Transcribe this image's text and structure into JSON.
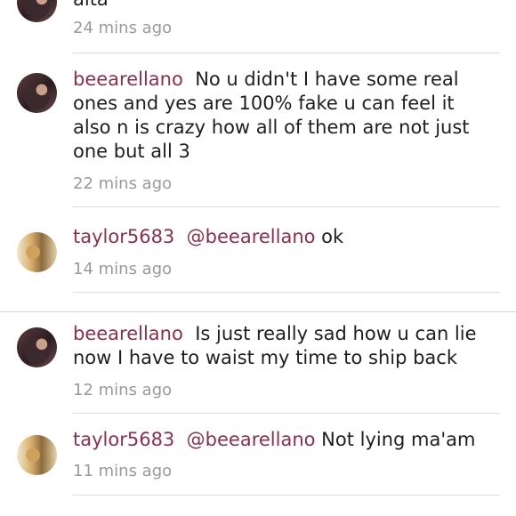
{
  "comments": [
    {
      "username": "",
      "text": "alta",
      "time": "24 mins ago"
    },
    {
      "username": "beearellano",
      "text": "No u didn't I have some real ones and yes are 100% fake u can feel it also n is crazy how all of them are not just one but all 3",
      "time": "22 mins ago"
    },
    {
      "username": "taylor5683",
      "mention": "@beearellano",
      "text": "ok",
      "time": "14 mins ago"
    },
    {
      "username": "beearellano",
      "text": "Is just really sad how u can lie now I have to waist my time to ship back",
      "time": "12 mins ago"
    },
    {
      "username": "taylor5683",
      "mention": "@beearellano",
      "text": "Not lying ma'am",
      "time": "11 mins ago"
    }
  ]
}
